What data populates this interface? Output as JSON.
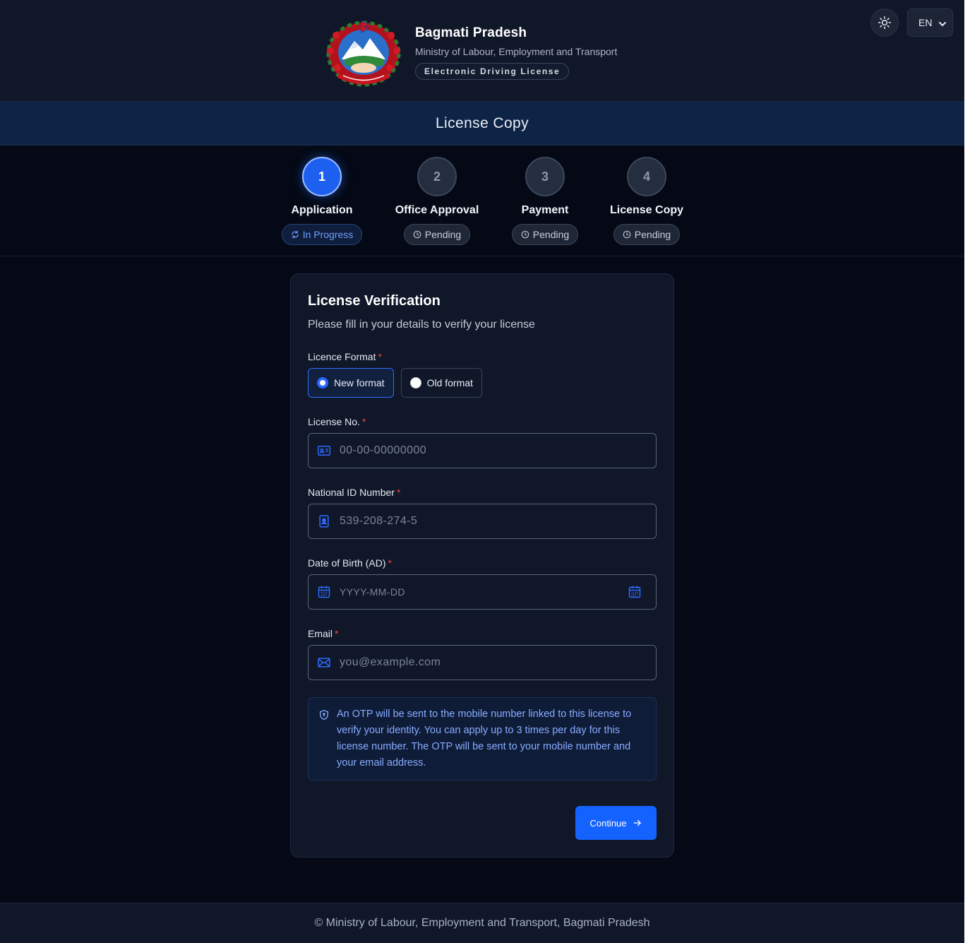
{
  "header": {
    "title": "Bagmati Pradesh",
    "subtitle": "Ministry of Labour, Employment and Transport",
    "badge": "Electronic Driving License",
    "language": "EN"
  },
  "page_title": "License Copy",
  "steps": [
    {
      "number": "1",
      "label": "Application",
      "status": "In Progress",
      "active": true
    },
    {
      "number": "2",
      "label": "Office Approval",
      "status": "Pending",
      "active": false
    },
    {
      "number": "3",
      "label": "Payment",
      "status": "Pending",
      "active": false
    },
    {
      "number": "4",
      "label": "License Copy",
      "status": "Pending",
      "active": false
    }
  ],
  "form": {
    "title": "License Verification",
    "subtitle": "Please fill in your details to verify your license",
    "licence_format": {
      "label": "Licence Format",
      "options": [
        "New format",
        "Old format"
      ],
      "selected": "New format"
    },
    "license_no": {
      "label": "License No.",
      "placeholder": "00-00-00000000",
      "value": ""
    },
    "national_id": {
      "label": "National ID Number",
      "placeholder": "539-208-274-5",
      "value": ""
    },
    "dob": {
      "label": "Date of Birth (AD)",
      "placeholder": "YYYY-MM-DD",
      "value": ""
    },
    "email": {
      "label": "Email",
      "placeholder": "you@example.com",
      "value": ""
    },
    "required_mark": "*",
    "info": "An OTP will be sent to the mobile number linked to this license to verify your identity. You can apply up to 3 times per day for this license number. The OTP will be sent to your mobile number and your email address.",
    "continue_label": "Continue"
  },
  "footer": "© Ministry of Labour, Employment and Transport, Bagmati Pradesh",
  "colors": {
    "accent": "#1563ff",
    "background": "#040915",
    "card": "#0f1729",
    "info_text": "#87acff",
    "required": "#ef4444"
  },
  "icons": {
    "theme": "sun-icon",
    "license": "id-card-icon",
    "national_id": "badge-icon",
    "dob": "calendar-icon",
    "email": "mail-icon",
    "info": "shield-icon",
    "continue": "arrow-right-icon"
  }
}
